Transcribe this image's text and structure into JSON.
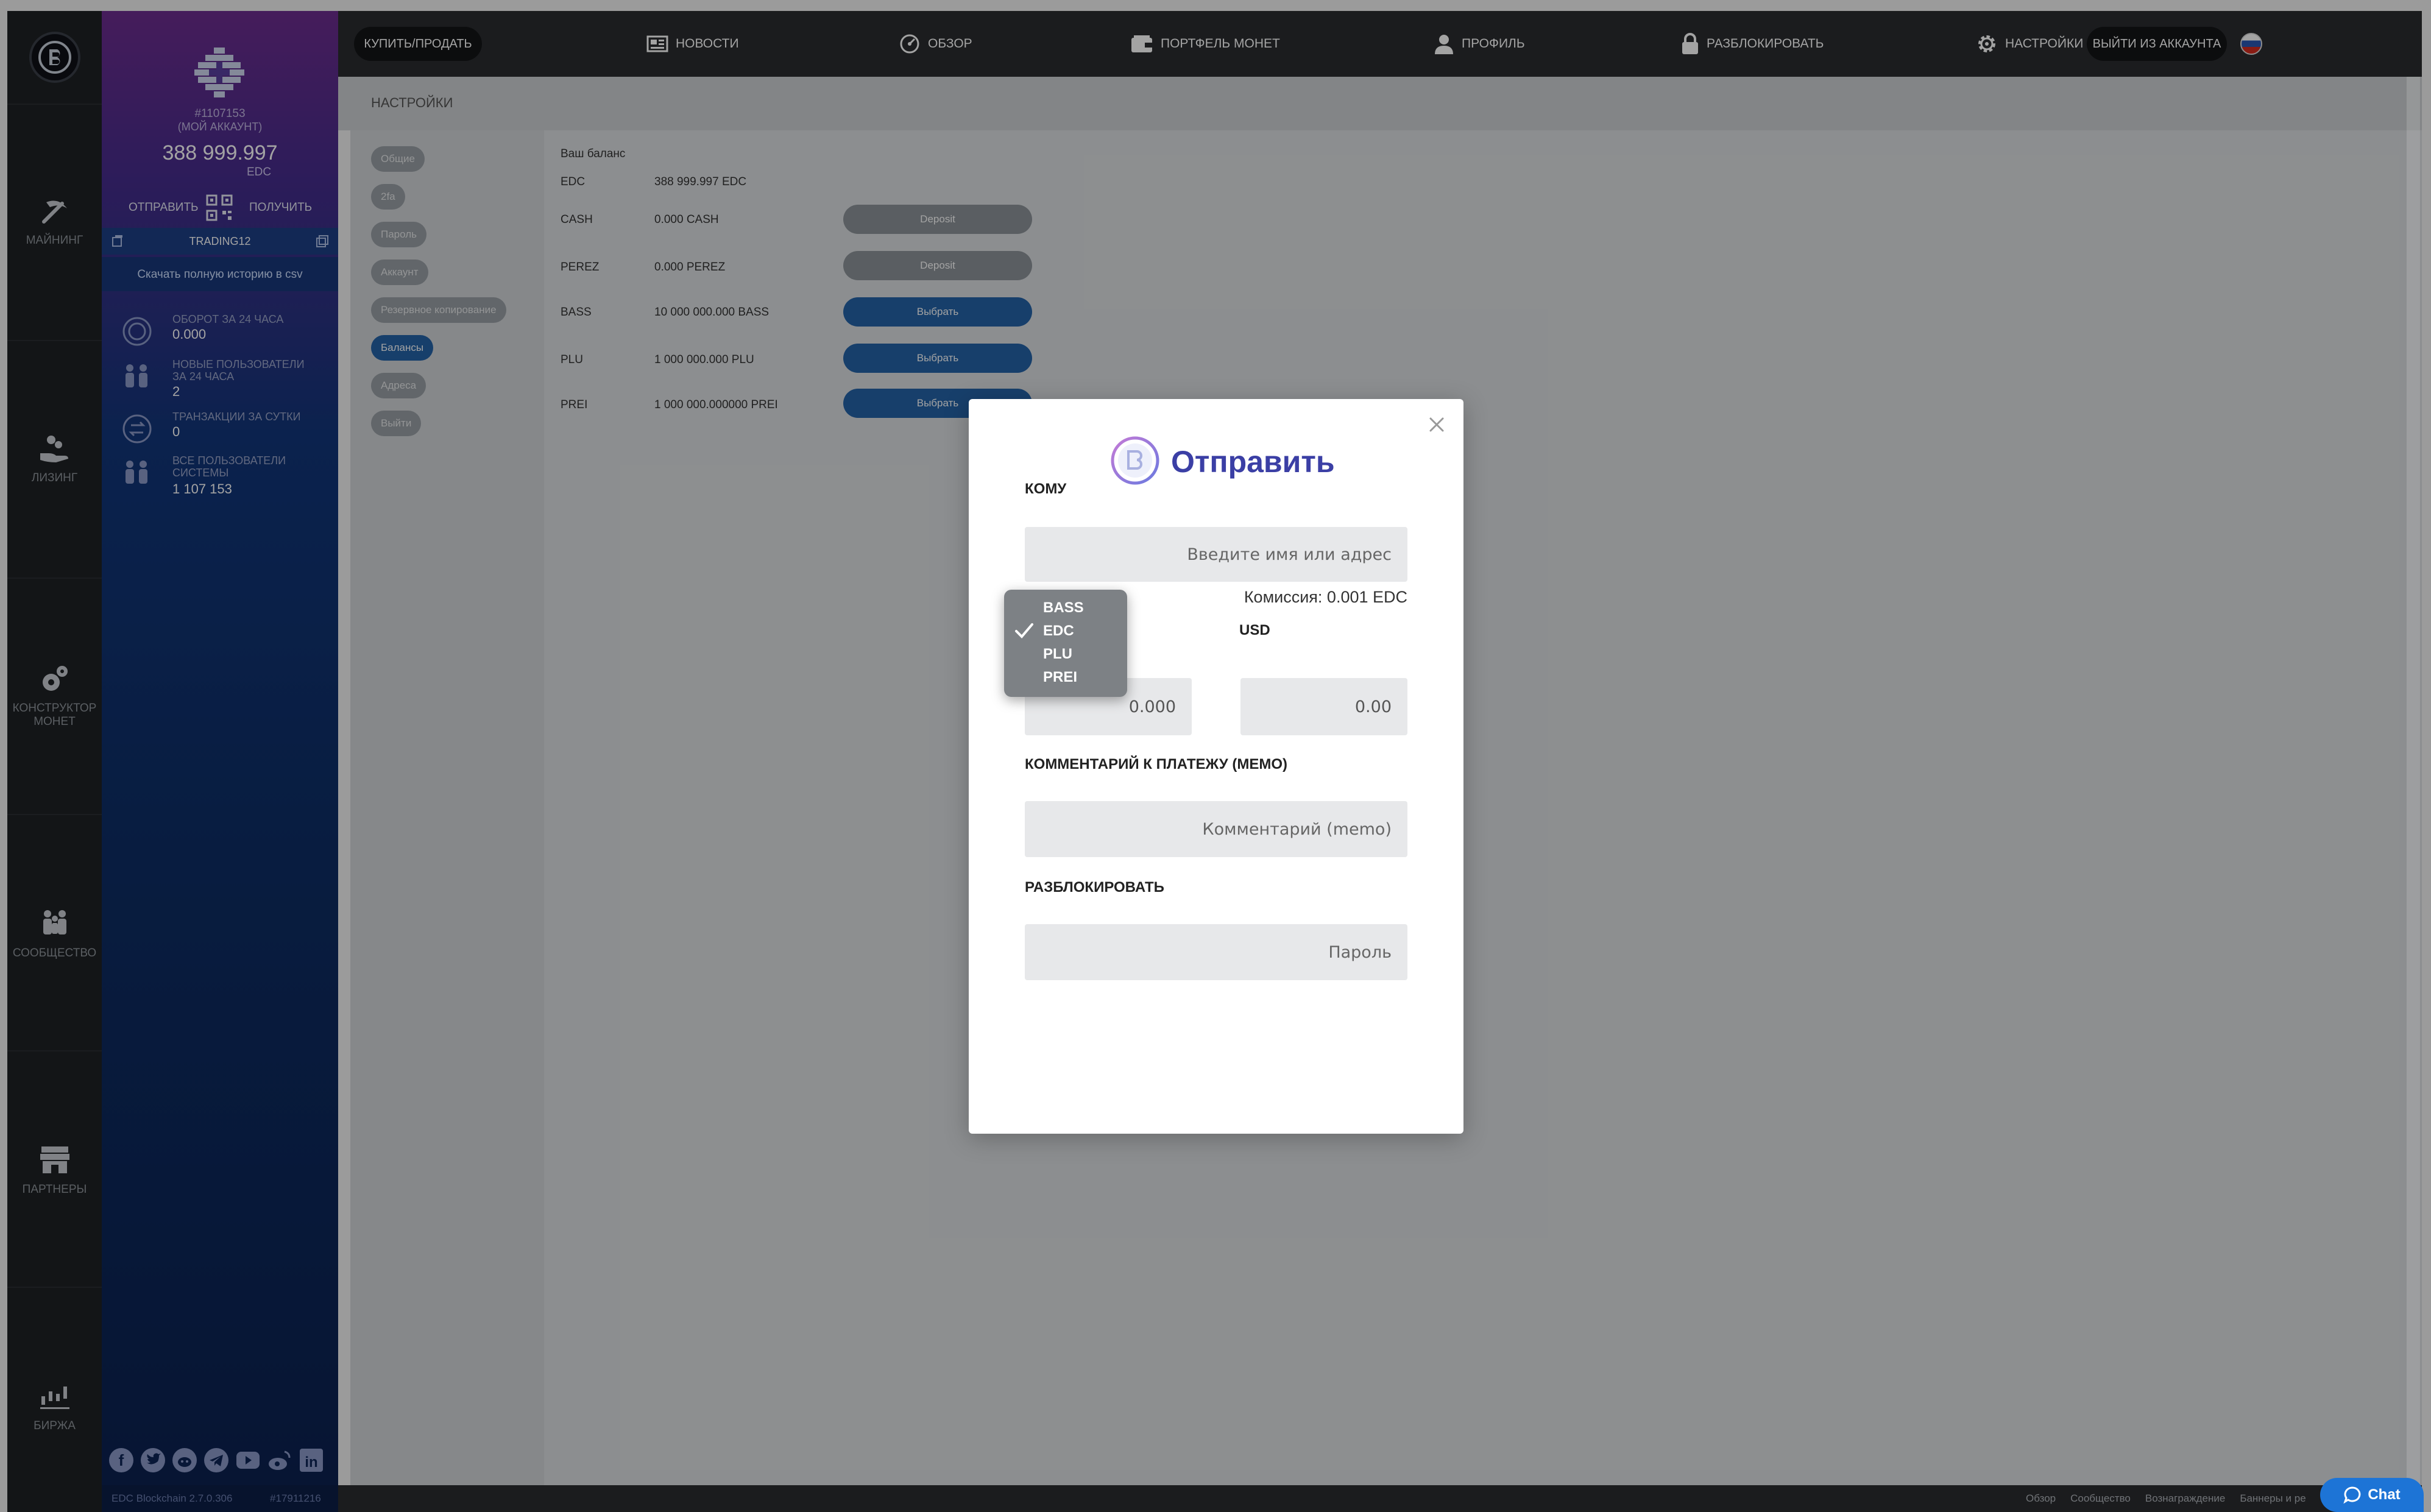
{
  "rail": {
    "items": [
      {
        "label": "МАЙНИНГ"
      },
      {
        "label": "ЛИЗИНГ"
      },
      {
        "label": "КОНСТРУКТОР МОНЕТ"
      },
      {
        "label": "СООБЩЕСТВО"
      },
      {
        "label": "ПАРТНЕРЫ"
      },
      {
        "label": "БИРЖА"
      }
    ]
  },
  "user": {
    "id": "#1107153",
    "account_note": "(МОЙ АККАУНТ)",
    "balance": "388 999.997",
    "currency": "EDC",
    "send_label": "ОТПРАВИТЬ",
    "receive_label": "ПОЛУЧИТЬ",
    "wallet_name": "TRADING12",
    "csv_link": "Скачать полную историю в csv",
    "stats": [
      {
        "label": "ОБОРОТ ЗА 24 ЧАСА",
        "value": "0.000"
      },
      {
        "label": "НОВЫЕ ПОЛЬЗОВАТЕЛИ ЗА 24 ЧАСА",
        "value": "2"
      },
      {
        "label": "ТРАНЗАКЦИИ ЗА СУТКИ",
        "value": "0"
      },
      {
        "label": "ВСЕ ПОЛЬЗОВАТЕЛИ СИСТЕМЫ",
        "value": "1 107 153"
      }
    ],
    "footer_version": "EDC Blockchain 2.7.0.306",
    "footer_block": "#17911216"
  },
  "topbar": {
    "buy_sell": "КУПИТЬ/ПРОДАТЬ",
    "news": "НОВОСТИ",
    "overview": "ОБЗОР",
    "portfolio": "ПОРТФЕЛЬ МОНЕТ",
    "profile": "ПРОФИЛЬ",
    "unlock": "РАЗБЛОКИРОВАТЬ",
    "settings": "НАСТРОЙКИ",
    "logout": "ВЫЙТИ ИЗ АККАУНТА"
  },
  "settings": {
    "title": "НАСТРОЙКИ",
    "menu": [
      "Общие",
      "2fa",
      "Пароль",
      "Аккаунт",
      "Резервное копирование",
      "Балансы",
      "Адреса",
      "Выйти"
    ],
    "active_index": 5,
    "balance_header": "Ваш баланс",
    "balances": [
      {
        "coin": "EDC",
        "amount": "388 999.997 EDC",
        "button": ""
      },
      {
        "coin": "CASH",
        "amount": "0.000 CASH",
        "button": "Deposit"
      },
      {
        "coin": "PEREZ",
        "amount": "0.000 PEREZ",
        "button": "Deposit"
      },
      {
        "coin": "BASS",
        "amount": "10 000 000.000 BASS",
        "button": "Выбрать"
      },
      {
        "coin": "PLU",
        "amount": "1 000 000.000 PLU",
        "button": "Выбрать"
      },
      {
        "coin": "PREI",
        "amount": "1 000 000.000000 PREI",
        "button": "Выбрать"
      }
    ]
  },
  "modal": {
    "title": "Отправить",
    "to_label": "КОМУ",
    "to_placeholder": "Введите имя или адрес",
    "commission": "Комиссия: 0.001 EDC",
    "usd_label": "USD",
    "amount_value": "0.000",
    "usd_value": "0.00",
    "memo_label": "КОММЕНТАРИЙ К ПЛАТЕЖУ (МЕМО)",
    "memo_placeholder": "Комментарий (memo)",
    "unlock_label": "РАЗБЛОКИРОВАТЬ",
    "password_placeholder": "Пароль"
  },
  "dropdown": {
    "options": [
      "BASS",
      "EDC",
      "PLU",
      "PREI"
    ],
    "selected": "EDC"
  },
  "footer": {
    "links": [
      "Обзор",
      "Сообщество",
      "Вознаграждение",
      "Баннеры и ре"
    ]
  },
  "chat": {
    "label": "Chat"
  },
  "colors": {
    "accent_blue": "#2563a8",
    "modal_title": "#3b3fa5",
    "chat_blue": "#1d74d6"
  }
}
